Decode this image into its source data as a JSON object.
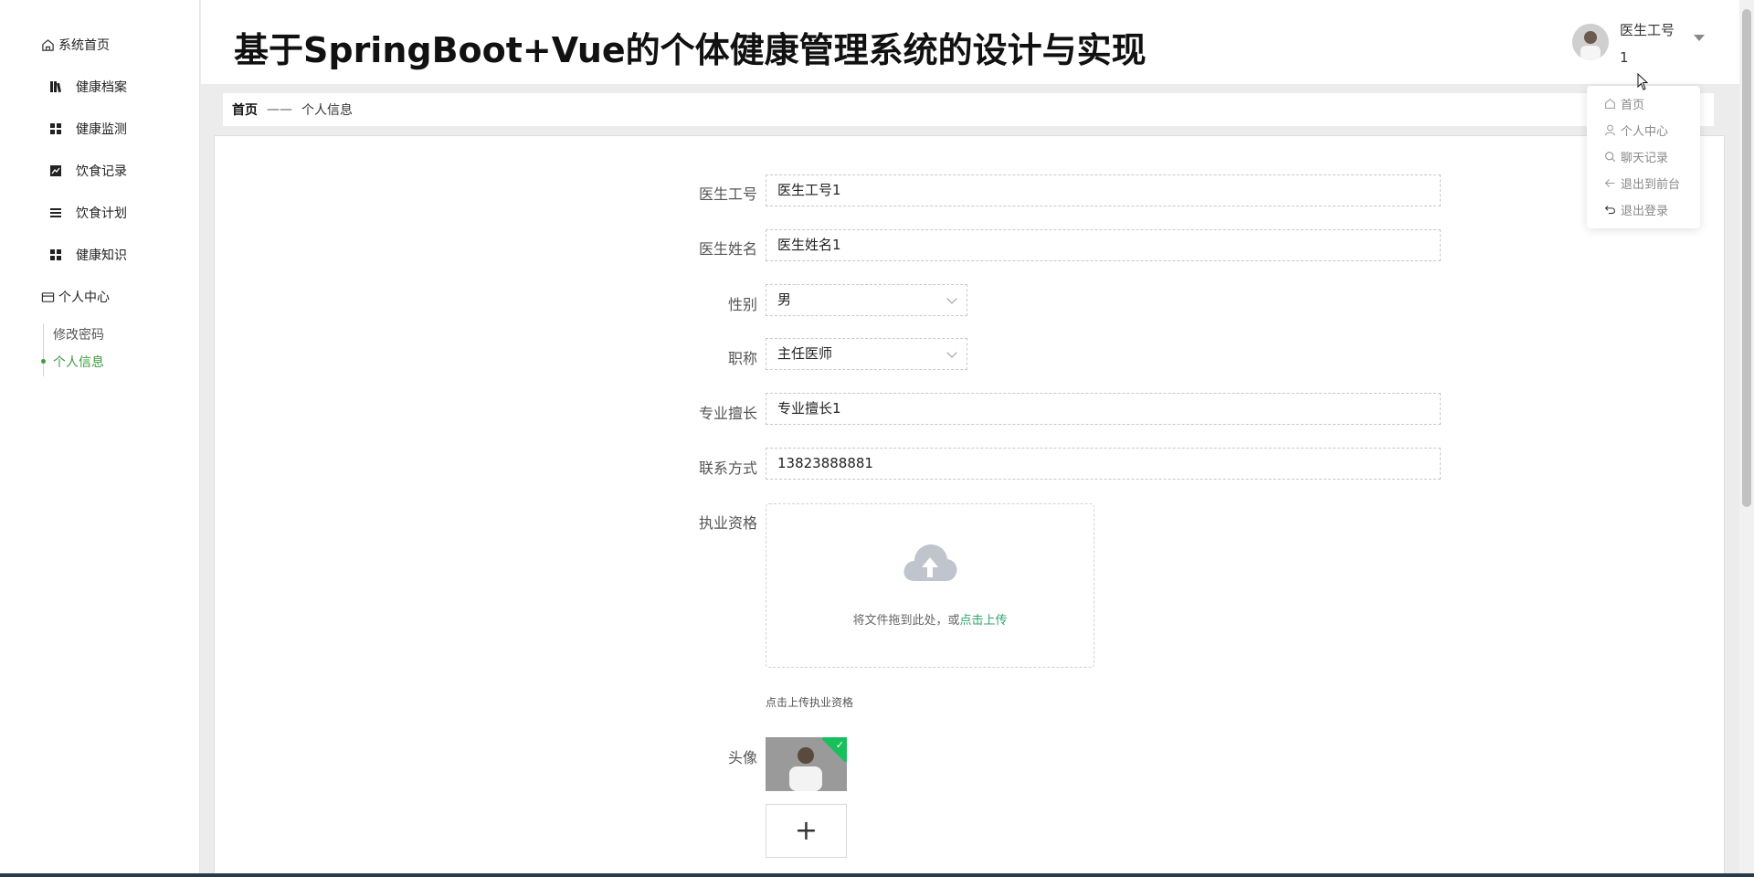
{
  "header": {
    "title": "基于SpringBoot+Vue的个体健康管理系统的设计与实现",
    "user_label": "医生工号",
    "user_value": "1"
  },
  "sidebar": {
    "home": "系统首页",
    "items": [
      {
        "label": "健康档案",
        "icon": "archive-icon"
      },
      {
        "label": "健康监测",
        "icon": "grid-icon"
      },
      {
        "label": "饮食记录",
        "icon": "chart-icon"
      },
      {
        "label": "饮食计划",
        "icon": "list-icon"
      },
      {
        "label": "健康知识",
        "icon": "grid-icon"
      }
    ],
    "personal_center": "个人中心",
    "sub_items": [
      {
        "label": "修改密码",
        "active": false
      },
      {
        "label": "个人信息",
        "active": true
      }
    ]
  },
  "breadcrumb": {
    "home": "首页",
    "separator": "——",
    "current": "个人信息"
  },
  "form": {
    "fields": [
      {
        "label": "医生工号",
        "value": "医生工号1"
      },
      {
        "label": "医生姓名",
        "value": "医生姓名1"
      },
      {
        "label": "性别",
        "value": "男"
      },
      {
        "label": "职称",
        "value": "主任医师"
      },
      {
        "label": "专业擅长",
        "value": "专业擅长1"
      },
      {
        "label": "联系方式",
        "value": "13823888881"
      }
    ],
    "license_label": "执业资格",
    "upload_text": "将文件拖到此处，或",
    "upload_link": "点击上传",
    "upload_hint": "点击上传执业资格",
    "avatar_label": "头像",
    "add_symbol": "+"
  },
  "dropdown": {
    "items": [
      {
        "label": "首页",
        "icon": "home-icon"
      },
      {
        "label": "个人中心",
        "icon": "user-icon"
      },
      {
        "label": "聊天记录",
        "icon": "search-icon"
      },
      {
        "label": "退出到前台",
        "icon": "arrow-left-icon"
      },
      {
        "label": "退出登录",
        "icon": "logout-icon"
      }
    ]
  },
  "colors": {
    "accent": "#3d9a3d",
    "link": "#2fa36b",
    "badge": "#18c05c"
  }
}
